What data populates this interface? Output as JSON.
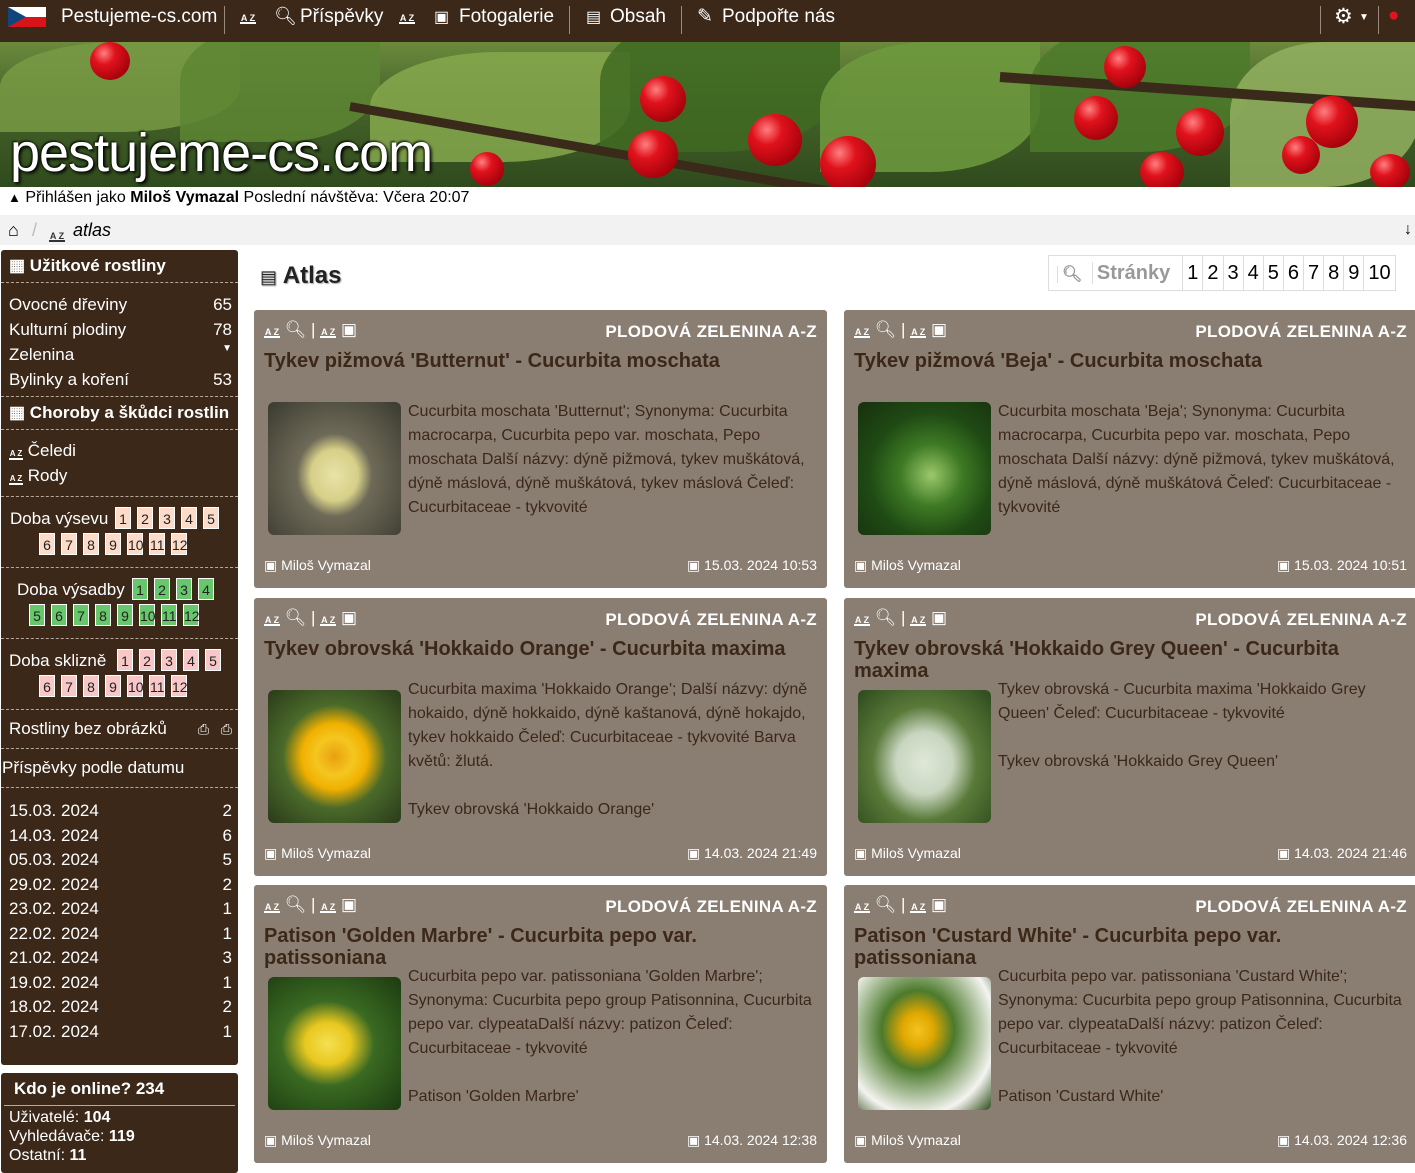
{
  "topnav": {
    "site": "Pestujeme-cs.com",
    "posts": "Příspěvky",
    "gallery": "Fotogalerie",
    "content": "Obsah",
    "support": "Podpořte nás"
  },
  "banner": {
    "logo": "pestujeme-cs.com"
  },
  "userbar": {
    "prefix": "Přihlášen jako",
    "user": "Miloš Vymazal",
    "last_label": "Poslední návštěva:",
    "last_value": "Včera 20:07"
  },
  "breadcrumb": {
    "current": "atlas"
  },
  "sidebar": {
    "useful_title": "Užitkové rostliny",
    "useful_items": [
      {
        "label": "Ovocné dřeviny",
        "count": "65"
      },
      {
        "label": "Kulturní plodiny",
        "count": "78"
      },
      {
        "label": "Zelenina",
        "count": ""
      },
      {
        "label": "Bylinky a koření",
        "count": "53"
      }
    ],
    "disease_title": "Choroby a škůdci rostlin",
    "families": "Čeledi",
    "genera": "Rody",
    "sowing": "Doba výsevu",
    "planting": "Doba výsadby",
    "harvest": "Doba sklizně",
    "months": [
      "1",
      "2",
      "3",
      "4",
      "5",
      "6",
      "7",
      "8",
      "9",
      "10",
      "11",
      "12"
    ],
    "no_images": "Rostliny bez obrázků",
    "by_date": "Příspěvky podle datumu",
    "dates": [
      {
        "date": "15.03. 2024",
        "count": "2"
      },
      {
        "date": "14.03. 2024",
        "count": "6"
      },
      {
        "date": "05.03. 2024",
        "count": "5"
      },
      {
        "date": "29.02. 2024",
        "count": "2"
      },
      {
        "date": "23.02. 2024",
        "count": "1"
      },
      {
        "date": "22.02. 2024",
        "count": "1"
      },
      {
        "date": "21.02. 2024",
        "count": "3"
      },
      {
        "date": "19.02. 2024",
        "count": "1"
      },
      {
        "date": "18.02. 2024",
        "count": "2"
      },
      {
        "date": "17.02. 2024",
        "count": "1"
      }
    ],
    "online_title": "Kdo je online? 234",
    "users_label": "Uživatelé:",
    "users_count": "104",
    "bots_label": "Vyhledávače:",
    "bots_count": "119",
    "others_label": "Ostatní:",
    "others_count": "11"
  },
  "main": {
    "title": "Atlas",
    "pager_label": "Stránky",
    "pages": [
      "1",
      "2",
      "3",
      "4",
      "5",
      "6",
      "7",
      "8",
      "9",
      "10"
    ]
  },
  "cards": [
    {
      "category": "PLODOVÁ ZELENINA A-Z",
      "title": "Tykev pižmová 'Butternut' - Cucurbita moschata",
      "desc": "Cucurbita moschata 'Butternut'; Synonyma: Cucurbita macrocarpa, Cucurbita pepo var. moschata, Pepo moschata Další názvy: dýně pižmová, tykev muškátová, dýně máslová, dýně muškátová, tykev máslová Čeleď: Cucurbitaceae - tykvovité",
      "author": "Miloš Vymazal",
      "date": "15.03. 2024 10:53"
    },
    {
      "category": "PLODOVÁ ZELENINA A-Z",
      "title": "Tykev pižmová 'Beja' - Cucurbita moschata",
      "desc": "Cucurbita moschata 'Beja'; Synonyma: Cucurbita macrocarpa, Cucurbita pepo var. moschata, Pepo moschata Další názvy: dýně pižmová, tykev muškátová, dýně máslová, dýně muškátová Čeleď: Cucurbitaceae - tykvovité",
      "author": "Miloš Vymazal",
      "date": "15.03. 2024 10:51"
    },
    {
      "category": "PLODOVÁ ZELENINA A-Z",
      "title": "Tykev obrovská 'Hokkaido Orange' - Cucurbita maxima",
      "desc": "Cucurbita maxima 'Hokkaido Orange'; Další názvy: dýně hokaido, dýně hokkaido, dýně kaštanová, dýně hokajdo, tykev hokkaido Čeleď: Cucurbitaceae - tykvovité Barva květů: žlutá.",
      "desc2": "Tykev obrovská 'Hokkaido Orange'",
      "author": "Miloš Vymazal",
      "date": "14.03. 2024 21:49"
    },
    {
      "category": "PLODOVÁ ZELENINA A-Z",
      "title": "Tykev obrovská 'Hokkaido Grey Queen' - Cucurbita maxima",
      "desc": "Tykev obrovská - Cucurbita maxima 'Hokkaido Grey Queen' Čeleď: Cucurbitaceae - tykvovité",
      "desc2": "Tykev obrovská 'Hokkaido Grey Queen'",
      "author": "Miloš Vymazal",
      "date": "14.03. 2024 21:46"
    },
    {
      "category": "PLODOVÁ ZELENINA A-Z",
      "title": "Patison 'Golden Marbre' - Cucurbita pepo var. patissoniana",
      "desc": "Cucurbita pepo var. patissoniana 'Golden Marbre'; Synonyma: Cucurbita pepo group Patisonnina, Cucurbita pepo var. clypeataDalší názvy: patizon Čeleď: Cucurbitaceae - tykvovité",
      "desc2": "Patison 'Golden Marbre'",
      "author": "Miloš Vymazal",
      "date": "14.03. 2024 12:38"
    },
    {
      "category": "PLODOVÁ ZELENINA A-Z",
      "title": "Patison 'Custard White' - Cucurbita pepo var. patissoniana",
      "desc": "Cucurbita pepo var. patissoniana 'Custard White'; Synonyma: Cucurbita pepo group Patisonnina, Cucurbita pepo var. clypeataDalší názvy: patizon Čeleď: Cucurbitaceae - tykvovité",
      "desc2": "Patison 'Custard White'",
      "author": "Miloš Vymazal",
      "date": "14.03. 2024 12:36"
    }
  ]
}
